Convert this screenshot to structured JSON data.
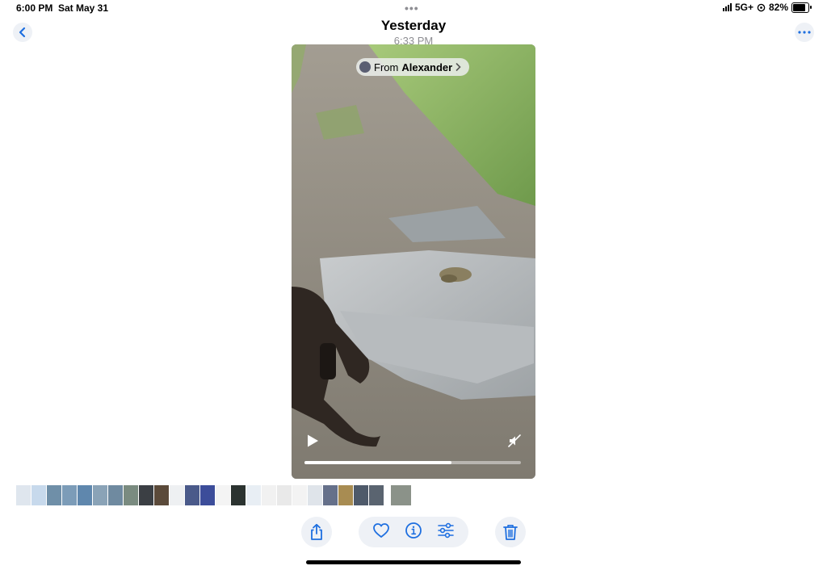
{
  "status_bar": {
    "time": "6:00 PM",
    "date": "Sat May 31",
    "network": "5G+",
    "battery": "82%",
    "battery_level": 0.82,
    "top_dots": "•••"
  },
  "header": {
    "title": "Yesterday",
    "subtitle": "6:33 PM",
    "back_icon": "chevron-left-icon",
    "more_icon": "ellipsis-icon"
  },
  "media": {
    "shared_from_prefix": "From",
    "shared_from_name": "Alexander",
    "playback_progress": 0.68
  },
  "thumbnails": [
    {
      "color": "#dfe6ee"
    },
    {
      "color": "#c7d9ec"
    },
    {
      "color": "#6f8fa8"
    },
    {
      "color": "#7c9cb8"
    },
    {
      "color": "#5f87ad"
    },
    {
      "color": "#8aa3b7"
    },
    {
      "color": "#6f8aa0"
    },
    {
      "color": "#7a8b80"
    },
    {
      "color": "#3b3f44"
    },
    {
      "color": "#5b4a3a"
    },
    {
      "color": "#eef0f2"
    },
    {
      "color": "#4a5a8a"
    },
    {
      "color": "#3c4d9a"
    },
    {
      "color": "#f4f4f4"
    },
    {
      "color": "#2b3330"
    },
    {
      "color": "#e8eef4"
    },
    {
      "color": "#f1f1f1"
    },
    {
      "color": "#e9e9e9"
    },
    {
      "color": "#f3f3f3"
    },
    {
      "color": "#dfe4ea"
    },
    {
      "color": "#65708a"
    },
    {
      "color": "#a88c52"
    },
    {
      "color": "#4e5a6a"
    },
    {
      "color": "#5a6470"
    },
    {
      "color": "#8b9289",
      "current": true
    }
  ],
  "toolbar": {
    "share_icon": "share-icon",
    "favorite_icon": "heart-icon",
    "info_icon": "info-icon",
    "adjust_icon": "sliders-icon",
    "delete_icon": "trash-icon"
  },
  "colors": {
    "accent": "#1e6fe0",
    "control_background": "#eef1f6",
    "subtitle_gray": "#8e8e93"
  }
}
